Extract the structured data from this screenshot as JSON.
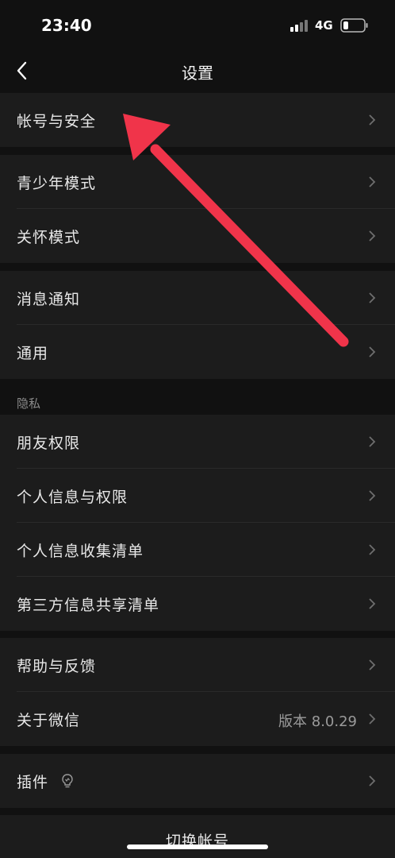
{
  "status": {
    "time": "23:40",
    "network": "4G"
  },
  "nav": {
    "title": "设置"
  },
  "groups": [
    {
      "items": [
        {
          "label": "帐号与安全"
        }
      ]
    },
    {
      "items": [
        {
          "label": "青少年模式"
        },
        {
          "label": "关怀模式"
        }
      ]
    },
    {
      "items": [
        {
          "label": "消息通知"
        },
        {
          "label": "通用"
        }
      ]
    },
    {
      "header": "隐私",
      "items": [
        {
          "label": "朋友权限"
        },
        {
          "label": "个人信息与权限"
        },
        {
          "label": "个人信息收集清单"
        },
        {
          "label": "第三方信息共享清单"
        }
      ]
    },
    {
      "items": [
        {
          "label": "帮助与反馈"
        },
        {
          "label": "关于微信",
          "value": "版本 8.0.29"
        }
      ]
    },
    {
      "items": [
        {
          "label": "插件"
        }
      ]
    }
  ],
  "bottom": {
    "switch_account": "切换帐号"
  },
  "colors": {
    "background": "#111111",
    "cell": "#1c1c1c",
    "annotation_arrow": "#f0344a"
  }
}
